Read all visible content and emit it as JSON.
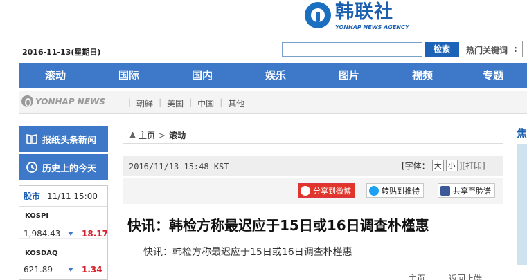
{
  "header": {
    "logo_cn": "韩联社",
    "logo_en": "YONHAP NEWS AGENCY",
    "date": "2016-11-13(星期日)",
    "search_placeholder": "",
    "search_button": "检索",
    "hot_keywords_label": "热门关键词",
    "hot_keywords_colon": ":"
  },
  "main_nav": [
    {
      "label": "滚动"
    },
    {
      "label": "国际"
    },
    {
      "label": "国内"
    },
    {
      "label": "娱乐"
    },
    {
      "label": "图片"
    },
    {
      "label": "视频"
    },
    {
      "label": "专题"
    }
  ],
  "sub_nav": {
    "logo_text": "YONHAP NEWS",
    "links": [
      {
        "label": "朝鲜"
      },
      {
        "label": "美国"
      },
      {
        "label": "中国"
      },
      {
        "label": "其他"
      }
    ]
  },
  "sidebar": {
    "btn_newspaper": "报纸头条新闻",
    "btn_history": "历史上的今天",
    "stock": {
      "label": "股市",
      "time": "11/11 15:00",
      "items": [
        {
          "name": "KOSPI",
          "value": "1,984.43",
          "change": "18.17"
        },
        {
          "name": "KOSDAQ",
          "value": "621.89",
          "change": "1.34"
        }
      ]
    }
  },
  "article": {
    "breadcrumb_home": "主页",
    "breadcrumb_sep": ">",
    "breadcrumb_section": "滚动",
    "pubdate": "2016/11/13 15:48 KST",
    "font_label": "[字体：",
    "font_large": "大",
    "font_small": "小",
    "print_label": "][打印]",
    "share_weibo": "分享到微博",
    "share_twitter": "转贴到推特",
    "share_facebook": "共享至脸谱",
    "headline": "快讯：韩检方称最迟应于15日或16日调查朴槿惠",
    "summary": "快讯：韩检方称最迟应于15日或16日调查朴槿惠",
    "bottom_home": "主页",
    "bottom_back": "返回上端"
  },
  "right_partial": {
    "title": "焦"
  },
  "colors": {
    "brand_blue": "#3d79c8",
    "logo_blue": "#1a5fb0",
    "up_red": "#d4202a",
    "weibo_red": "#e0352b"
  }
}
